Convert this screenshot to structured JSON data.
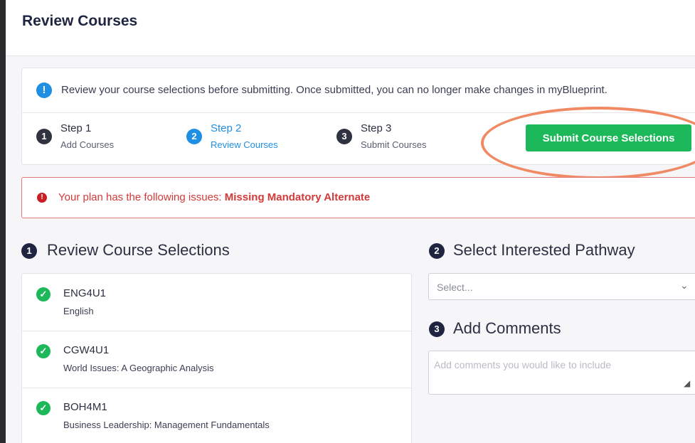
{
  "header": {
    "title": "Review Courses"
  },
  "info": {
    "icon": "info-icon",
    "text": "Review your course selections before submitting. Once submitted, you can no longer make changes in myBlueprint."
  },
  "steps": [
    {
      "num": "1",
      "title": "Step 1",
      "sub": "Add Courses",
      "active": false
    },
    {
      "num": "2",
      "title": "Step 2",
      "sub": "Review Courses",
      "active": true
    },
    {
      "num": "3",
      "title": "Step 3",
      "sub": "Submit Courses",
      "active": false
    }
  ],
  "submit": {
    "label": "Submit Course Selections"
  },
  "alert": {
    "icon": "alert-icon",
    "prefix": "Your plan has the following issues: ",
    "issue": "Missing Mandatory Alternate"
  },
  "sections": {
    "review": {
      "num": "1",
      "title": "Review Course Selections"
    },
    "pathway": {
      "num": "2",
      "title": "Select Interested Pathway",
      "placeholder": "Select..."
    },
    "comments": {
      "num": "3",
      "title": "Add Comments",
      "placeholder": "Add comments you would like to include"
    }
  },
  "courses": [
    {
      "code": "ENG4U1",
      "name": "English"
    },
    {
      "code": "CGW4U1",
      "name": "World Issues: A Geographic Analysis"
    },
    {
      "code": "BOH4M1",
      "name": "Business Leadership: Management Fundamentals"
    }
  ],
  "colors": {
    "accent": "#1f8fe3",
    "success": "#1db85a",
    "error": "#d23a3a",
    "highlight": "#f08a65"
  }
}
